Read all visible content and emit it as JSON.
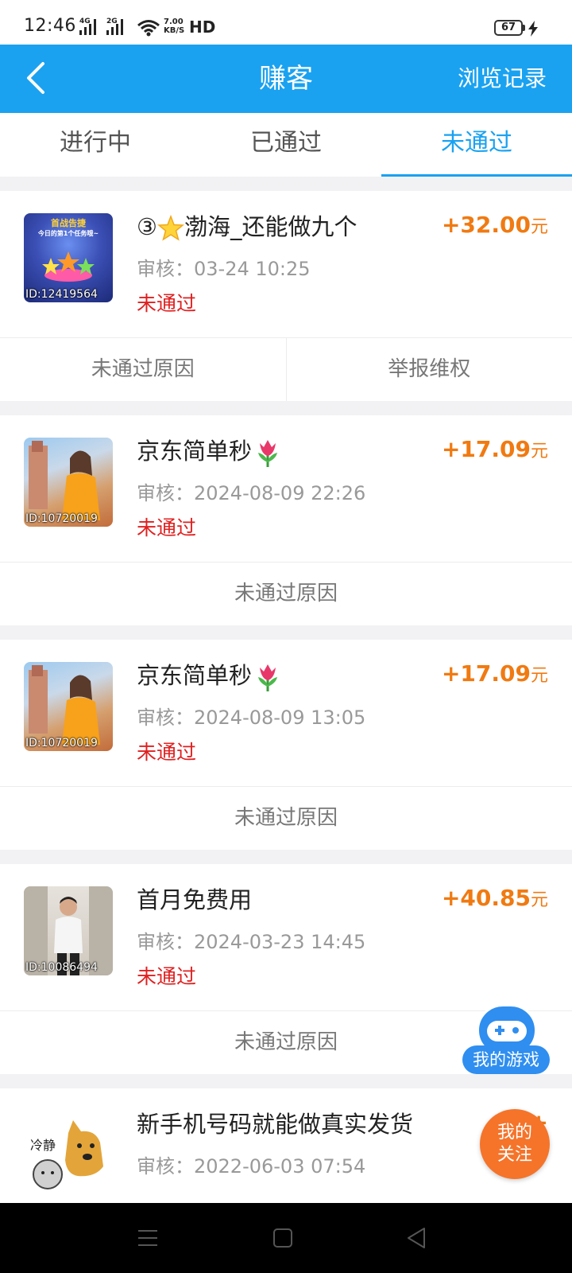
{
  "status_bar": {
    "time": "12:46",
    "signal1": "4G",
    "signal2": "2G",
    "speed_value": "7.00",
    "speed_unit": "KB/S",
    "hd": "HD",
    "battery": "67"
  },
  "header": {
    "back_icon": "chevron-left-icon",
    "title": "赚客",
    "history_label": "浏览记录",
    "color": "#1aa2f1"
  },
  "tabs": [
    {
      "label": "进行中",
      "active": false
    },
    {
      "label": "已通过",
      "active": false
    },
    {
      "label": "未通过",
      "active": true
    }
  ],
  "tasks": [
    {
      "id_label": "ID:12419564",
      "title": "③",
      "title_emoji": "star-icon",
      "title_rest": "渤海_还能做九个",
      "review": "审核：03-24 10:25",
      "status": "未通过",
      "reward": "+32.00",
      "unit": "元",
      "actions": [
        "未通过原因",
        "举报维权"
      ],
      "thumb_caption_lines": [
        "首战告捷",
        "今日的第1个任务哦~"
      ]
    },
    {
      "id_label": "ID:10720019",
      "title": "京东简单秒",
      "title_emoji": "tulip-icon",
      "review": "审核：2024-08-09 22:26",
      "status": "未通过",
      "reward": "+17.09",
      "unit": "元",
      "actions": [
        "未通过原因"
      ]
    },
    {
      "id_label": "ID:10720019",
      "title": "京东简单秒",
      "title_emoji": "tulip-icon",
      "review": "审核：2024-08-09 13:05",
      "status": "未通过",
      "reward": "+17.09",
      "unit": "元",
      "actions": [
        "未通过原因"
      ]
    },
    {
      "id_label": "ID:10086494",
      "title": "首月免费用",
      "review": "审核：2024-03-23 14:45",
      "status": "未通过",
      "reward": "+40.85",
      "unit": "元",
      "actions": [
        "未通过原因"
      ]
    },
    {
      "title": "新手机号码就能做真实发货",
      "review": "审核：2022-06-03 07:54",
      "reward_partial": "+",
      "thumb_text": "冷静"
    }
  ],
  "floating": {
    "games_icon": "gamepad-icon",
    "games_label": "我的游戏",
    "follow_line1": "我的",
    "follow_line2": "关注"
  },
  "colors": {
    "reward": "#f07a12",
    "status_failed": "#e02020",
    "tab_active": "#1aa2f1"
  }
}
